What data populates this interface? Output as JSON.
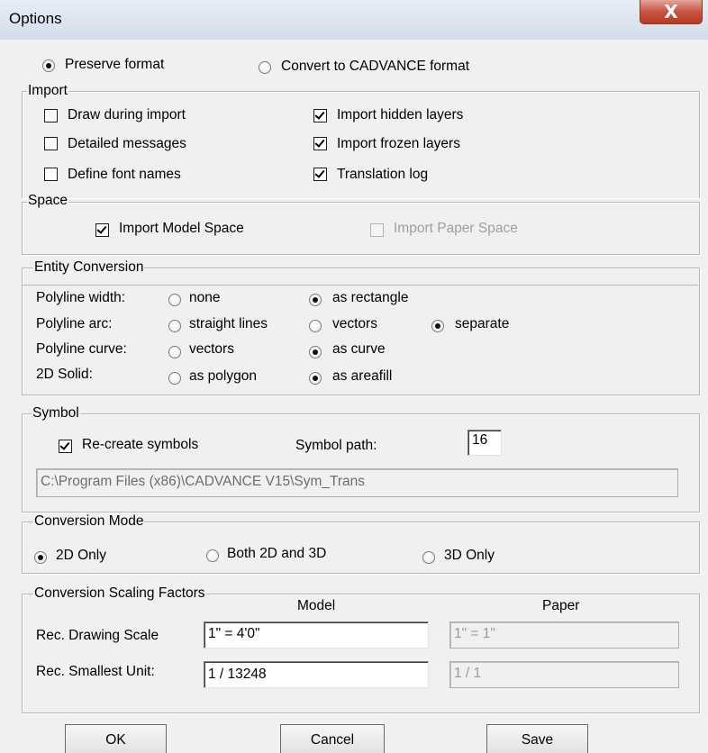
{
  "window": {
    "title": "Options",
    "close_glyph": "X"
  },
  "format": {
    "preserve_label": "Preserve format",
    "convert_label": "Convert to CADVANCE format",
    "selected": "preserve"
  },
  "import": {
    "legend": "Import",
    "draw_during_import": {
      "label": "Draw during import",
      "checked": false
    },
    "detailed_messages": {
      "label": "Detailed messages",
      "checked": false
    },
    "define_font_names": {
      "label": "Define font names",
      "checked": false
    },
    "import_hidden_layers": {
      "label": "Import hidden layers",
      "checked": true
    },
    "import_frozen_layers": {
      "label": "Import frozen layers",
      "checked": true
    },
    "translation_log": {
      "label": "Translation log",
      "checked": true
    }
  },
  "space": {
    "legend": "Space",
    "model_space": {
      "label": "Import Model Space",
      "checked": true
    },
    "paper_space": {
      "label": "Import Paper Space",
      "checked": false,
      "disabled": true
    }
  },
  "entity_conversion": {
    "legend": "Entity Conversion",
    "polyline_width": {
      "label": "Polyline width:",
      "opt1": "none",
      "opt2": "as rectangle",
      "selected": "as rectangle"
    },
    "polyline_arc": {
      "label": "Polyline arc:",
      "opt1": "straight lines",
      "opt2": "vectors",
      "opt3": "separate",
      "selected": "separate"
    },
    "polyline_curve": {
      "label": "Polyline curve:",
      "opt1": "vectors",
      "opt2": "as curve",
      "selected": "as curve"
    },
    "solid_2d": {
      "label": "2D Solid:",
      "opt1": "as polygon",
      "opt2": "as areafill",
      "selected": "as areafill"
    }
  },
  "symbol": {
    "legend": "Symbol",
    "recreate": {
      "label": "Re-create symbols",
      "checked": true
    },
    "path_label": "Symbol path:",
    "path_value": "16",
    "path_display": "C:\\Program Files (x86)\\CADVANCE V15\\Sym_Trans"
  },
  "conversion_mode": {
    "legend": "Conversion Mode",
    "opt_2d": "2D Only",
    "opt_both": "Both 2D and 3D",
    "opt_3d": "3D Only",
    "selected": "2D Only"
  },
  "scaling": {
    "legend": "Conversion Scaling Factors",
    "model_header": "Model",
    "paper_header": "Paper",
    "drawing_scale_label": "Rec. Drawing Scale",
    "drawing_scale_model": "1\" = 4'0\"",
    "drawing_scale_paper": "1\" = 1\"",
    "smallest_unit_label": "Rec. Smallest Unit:",
    "smallest_unit_model": "1 / 13248",
    "smallest_unit_paper": "1 / 1"
  },
  "buttons": {
    "ok": "OK",
    "cancel": "Cancel",
    "save": "Save"
  }
}
